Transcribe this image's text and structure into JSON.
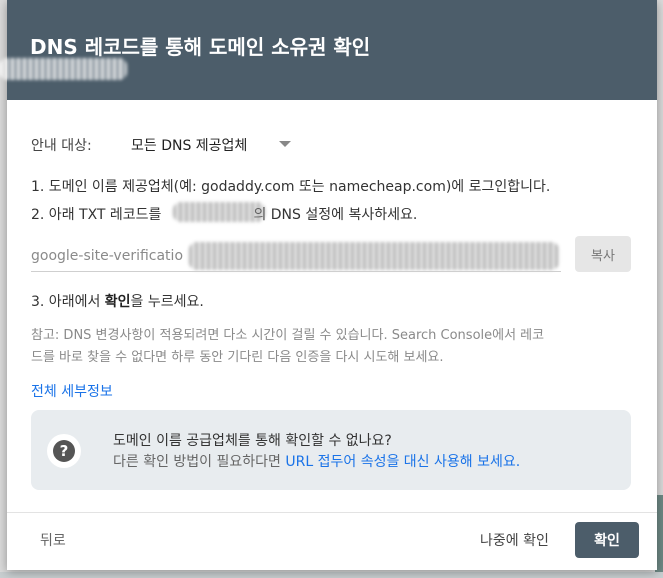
{
  "dialog": {
    "title": "DNS 레코드를 통해 도메인 소유권 확인",
    "provider_label": "안내 대상:",
    "provider_value": "모든 DNS 제공업체",
    "step1": "1. 도메인 이름 제공업체(예: godaddy.com 또는 namecheap.com)에 로그인합니다.",
    "step2_prefix": "2. 아래 TXT 레코드를",
    "step2_suffix": "의 DNS 설정에 복사하세요.",
    "txt_record_value": "google-site-verificatio",
    "copy_label": "복사",
    "step3_prefix": "3. 아래에서 ",
    "step3_bold": "확인",
    "step3_suffix": "을 누르세요.",
    "note_line1": "참고: DNS 변경사항이 적용되려면 다소 시간이 걸릴 수 있습니다. Search Console에서 레코",
    "note_line2": "드를 바로 찾을 수 없다면 하루 동안 기다린 다음 인증을 다시 시도해 보세요.",
    "details_link": "전체 세부정보",
    "info_icon": "question-icon",
    "info_title": "도메인 이름 공급업체를 통해 확인할 수 없나요?",
    "info_body_prefix": "다른 확인 방법이 필요하다면 ",
    "info_body_link": "URL 접두어 속성을 대신 사용해 보세요.",
    "back_label": "뒤로",
    "later_label": "나중에 확인",
    "confirm_label": "확인"
  },
  "colors": {
    "header_bg": "#4c5d6a",
    "link": "#1a73e8",
    "info_bg": "#e8ecef"
  }
}
